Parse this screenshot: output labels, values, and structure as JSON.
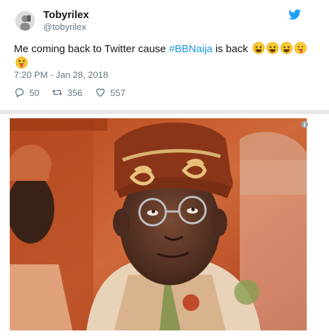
{
  "tweet": {
    "display_name": "Tobyrilex",
    "handle": "@tobyrilex",
    "text_before": "Me coming back to Twitter cause ",
    "hashtag": "#BBNaija",
    "text_after": " is back",
    "emojis": [
      "grinning-squinting-face",
      "grinning-squinting-face",
      "grinning-squinting-face",
      "winking-face-with-tongue",
      "squinting-face-with-tongue"
    ],
    "timestamp": "7:20 PM - Jan 28, 2018",
    "replies": "50",
    "retweets": "356",
    "likes": "557",
    "colors": {
      "link": "#1b95e0",
      "muted": "#657786",
      "twitter_blue": "#1da1f2"
    }
  },
  "media": {
    "info_glyph": "i",
    "icon": "info-icon"
  }
}
